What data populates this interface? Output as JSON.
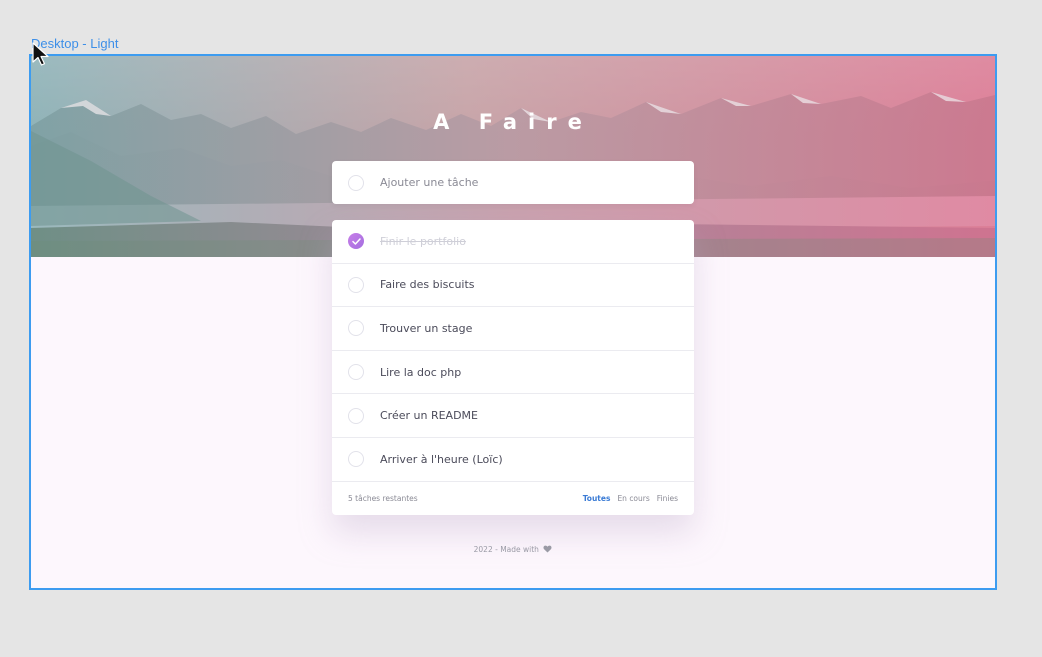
{
  "frame": {
    "label": "Desktop - Light"
  },
  "app": {
    "title": "A Faire"
  },
  "new_task": {
    "placeholder": "Ajouter une tâche"
  },
  "todos": [
    {
      "label": "Finir le portfolio",
      "done": true
    },
    {
      "label": "Faire des biscuits",
      "done": false
    },
    {
      "label": "Trouver un stage",
      "done": false
    },
    {
      "label": "Lire la doc php",
      "done": false
    },
    {
      "label": "Créer un README",
      "done": false
    },
    {
      "label": "Arriver à l'heure (Loïc)",
      "done": false
    }
  ],
  "footer": {
    "remaining": "5 tâches restantes",
    "filters": [
      {
        "label": "Toutes",
        "active": true
      },
      {
        "label": "En cours",
        "active": false
      },
      {
        "label": "Finies",
        "active": false
      }
    ]
  },
  "credit": {
    "text": "2022 - Made with",
    "icon": "heart-icon"
  },
  "colors": {
    "accent": "#3a7bd5",
    "check_gradient_start": "#c77ee8",
    "check_gradient_end": "#a46fe0",
    "selection": "#3d9cf0"
  }
}
